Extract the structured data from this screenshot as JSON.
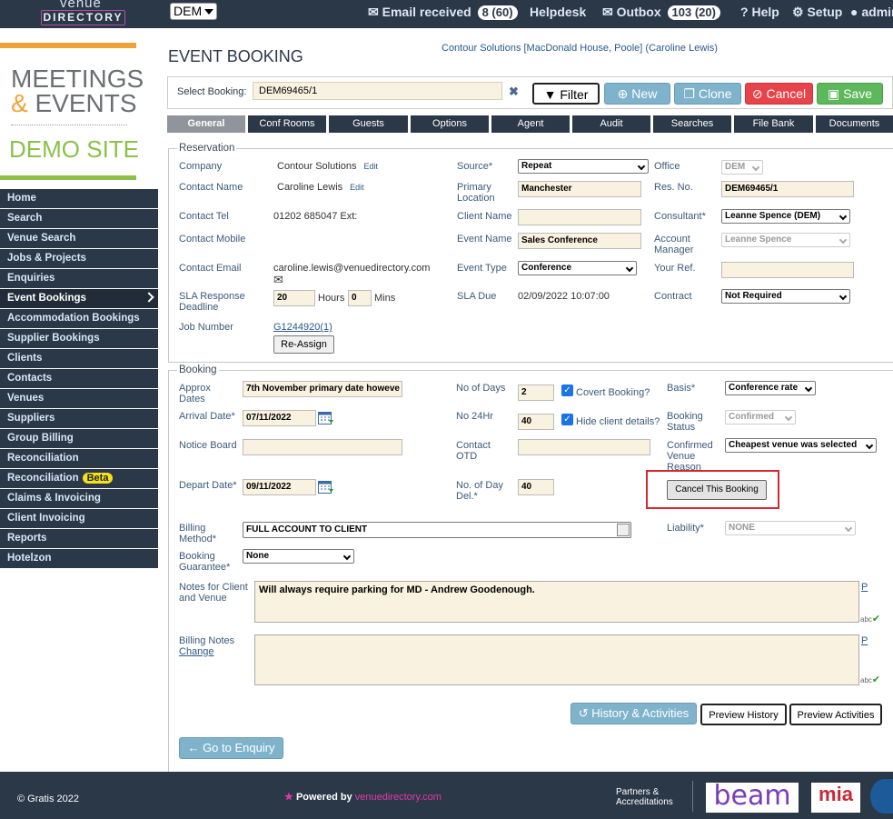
{
  "topbar": {
    "logo_line1": "venue",
    "logo_line2": "DIRECTORY",
    "office_select": "DEM",
    "email_received": "Email received",
    "email_count": "8 (60)",
    "helpdesk": "Helpdesk",
    "outbox": "Outbox",
    "outbox_count": "103 (20)",
    "help": "Help",
    "setup": "Setup",
    "user": "admin"
  },
  "brand": {
    "line1": "MEETINGS",
    "amp": "&",
    "line2": "EVENTS",
    "site": "DEMO SITE"
  },
  "nav": [
    "Home",
    "Search",
    "Venue Search",
    "Jobs & Projects",
    "Enquiries",
    "Event Bookings",
    "Accommodation Bookings",
    "Supplier Bookings",
    "Clients",
    "Contacts",
    "Venues",
    "Suppliers",
    "Group Billing",
    "Reconciliation",
    "Reconciliation",
    "Claims & Invoicing",
    "Client Invoicing",
    "Reports",
    "Hotelzon"
  ],
  "nav_beta": "Beta",
  "header": {
    "title": "EVENT BOOKING",
    "crumb": "Contour Solutions [MacDonald House, Poole] (Caroline Lewis)",
    "select_label": "Select Booking:",
    "select_value": "DEM69465/1",
    "filter": "Filter",
    "new": "New",
    "clone": "Clone",
    "cancel": "Cancel",
    "save": "Save"
  },
  "tabs": [
    "General",
    "Conf Rooms",
    "Guests",
    "Options",
    "Agent",
    "Audit",
    "Searches",
    "File Bank",
    "Documents"
  ],
  "reservation": {
    "legend": "Reservation",
    "company_label": "Company",
    "company": "Contour Solutions",
    "edit": "Edit",
    "contact_name_label": "Contact Name",
    "contact_name": "Caroline Lewis",
    "contact_tel_label": "Contact Tel",
    "contact_tel": "01202 685047 Ext:",
    "contact_mobile_label": "Contact Mobile",
    "contact_email_label": "Contact Email",
    "contact_email": "caroline.lewis@venuedirectory.com",
    "sla_label": "SLA Response Deadline",
    "sla_hours": "20",
    "hours": "Hours",
    "sla_mins": "0",
    "mins": "Mins",
    "job_label": "Job Number",
    "job": "G1244920",
    "job_count": "(1)",
    "reassign": "Re-Assign",
    "source_label": "Source*",
    "source": "Repeat",
    "primary_loc_label": "Primary Location",
    "primary_loc": "Manchester",
    "client_name_label": "Client Name",
    "event_name_label": "Event Name",
    "event_name": "Sales Conference",
    "event_type_label": "Event Type",
    "event_type": "Conference",
    "sla_due_label": "SLA Due",
    "sla_due": "02/09/2022 10:07:00",
    "office_label": "Office",
    "office": "DEM",
    "res_no_label": "Res. No.",
    "res_no": "DEM69465/1",
    "consultant_label": "Consultant*",
    "consultant": "Leanne Spence (DEM)",
    "account_mgr_label": "Account Manager",
    "account_mgr": "Leanne Spence",
    "your_ref_label": "Your Ref.",
    "contract_label": "Contract",
    "contract": "Not Required"
  },
  "booking": {
    "legend": "Booking",
    "approx_label": "Approx Dates",
    "approx": "7th November primary date howeve",
    "arrival_label": "Arrival Date*",
    "arrival": "07/11/2022",
    "notice_label": "Notice Board",
    "depart_label": "Depart Date*",
    "depart": "09/11/2022",
    "days_label": "No of Days",
    "days": "2",
    "covert": "Covert Booking?",
    "no24_label": "No 24Hr",
    "no24": "40",
    "hide_client": "Hide client details?",
    "contact_otd_label": "Contact OTD",
    "day_del_label": "No. of Day Del.*",
    "day_del": "40",
    "basis_label": "Basis*",
    "basis": "Conference rate",
    "status_label": "Booking Status",
    "status": "Confirmed",
    "confirmed_reason_label": "Confirmed Venue Reason",
    "confirmed_reason": "Cheapest venue was selected",
    "cancel_booking": "Cancel This Booking",
    "billing_method_label": "Billing Method*",
    "billing_method": "FULL ACCOUNT TO CLIENT",
    "liability_label": "Liability*",
    "liability": "NONE",
    "guarantee_label": "Booking Guarantee*",
    "guarantee": "None",
    "notes_label": "Notes for Client and Venue",
    "notes": "Will always require parking for MD - Andrew Goodenough.",
    "billing_notes_label": "Billing Notes",
    "change": "Change",
    "p": "P",
    "abc": "abc"
  },
  "actions": {
    "history": "History & Activities",
    "preview_history": "Preview History",
    "preview_activities": "Preview Activities",
    "go_enquiry": "Go to Enquiry"
  },
  "footer": {
    "copyright": "© Gratis 2022",
    "powered": "Powered by",
    "powered_brand": "venuedirectory.com",
    "partners": "Partners & Accreditations",
    "beam": "beam",
    "mia": "mia"
  }
}
